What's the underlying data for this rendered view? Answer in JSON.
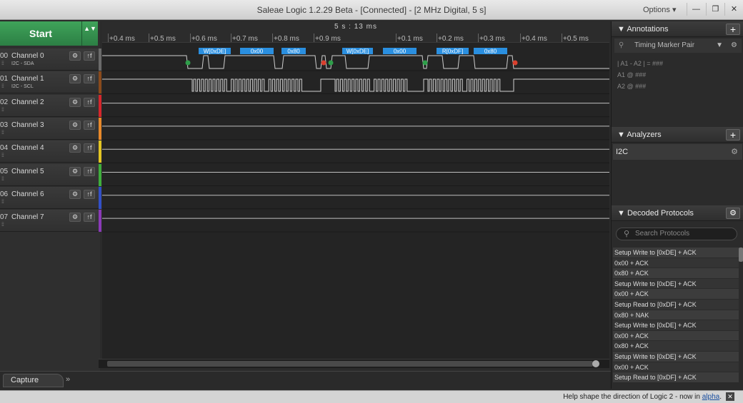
{
  "window": {
    "title": "Saleae Logic 1.2.29 Beta - [Connected] - [2 MHz Digital, 5 s]",
    "options_label": "Options ▾",
    "minimize_glyph": "—",
    "restore_glyph": "❐",
    "close_glyph": "✕"
  },
  "controls": {
    "start_label": "Start",
    "updown_glyph": "▲▼"
  },
  "channels": [
    {
      "num": "00",
      "name": "Channel 0",
      "sub": "I2C - SDA",
      "color": "#6b6b6b"
    },
    {
      "num": "01",
      "name": "Channel 1",
      "sub": "I2C - SCL",
      "color": "#8a4a1c"
    },
    {
      "num": "02",
      "name": "Channel 2",
      "sub": "",
      "color": "#d6262c"
    },
    {
      "num": "03",
      "name": "Channel 3",
      "sub": "",
      "color": "#e8892a"
    },
    {
      "num": "04",
      "name": "Channel 4",
      "sub": "",
      "color": "#e3c523"
    },
    {
      "num": "05",
      "name": "Channel 5",
      "sub": "",
      "color": "#3fae3c"
    },
    {
      "num": "06",
      "name": "Channel 6",
      "sub": "",
      "color": "#3350c8"
    },
    {
      "num": "07",
      "name": "Channel 7",
      "sub": "",
      "color": "#8b3ab8"
    }
  ],
  "timeline": {
    "center_label": "5 s : 13 ms",
    "ticks": [
      "+0.4 ms",
      "+0.5 ms",
      "+0.6 ms",
      "+0.7 ms",
      "+0.8 ms",
      "+0.9 ms",
      "+0.1 ms",
      "+0.2 ms",
      "+0.3 ms",
      "+0.4 ms",
      "+0.5 ms"
    ]
  },
  "decode_bubbles": [
    "W[0xDE]",
    "0x00",
    "0x80",
    "W[0xDE]",
    "0x00",
    "R[0xDF]",
    "0x80"
  ],
  "capture": {
    "label": "Capture",
    "expand_glyph": "»"
  },
  "annotations": {
    "header": "Annotations",
    "add_glyph": "+",
    "dropdown": "Timing Marker Pair",
    "line1": "| A1 - A2 | = ###",
    "line2": "A1  @  ###",
    "line3": "A2  @  ###"
  },
  "analyzers": {
    "header": "Analyzers",
    "add_glyph": "+",
    "items": [
      "I2C"
    ]
  },
  "decoded": {
    "header": "Decoded Protocols",
    "search_placeholder": "Search Protocols",
    "items": [
      "Setup Write to [0xDE] + ACK",
      "0x00 + ACK",
      "0x80 + ACK",
      "Setup Write to [0xDE] + ACK",
      "0x00 + ACK",
      "Setup Read to [0xDF] + ACK",
      "0x80 + NAK",
      "Setup Write to [0xDE] + ACK",
      "0x00 + ACK",
      "0x80 + ACK",
      "Setup Write to [0xDE] + ACK",
      "0x00 + ACK",
      "Setup Read to [0xDF] + ACK"
    ]
  },
  "status": {
    "message_prefix": "Help shape the direction of Logic 2 - now in ",
    "message_link": "alpha",
    "message_suffix": ".",
    "close_glyph": "✕"
  },
  "colors": {
    "start_green": "#3fa35a",
    "bubble_blue": "#2a8fe0",
    "start_marker": "#2f9e4a",
    "stop_marker": "#d9402e"
  }
}
